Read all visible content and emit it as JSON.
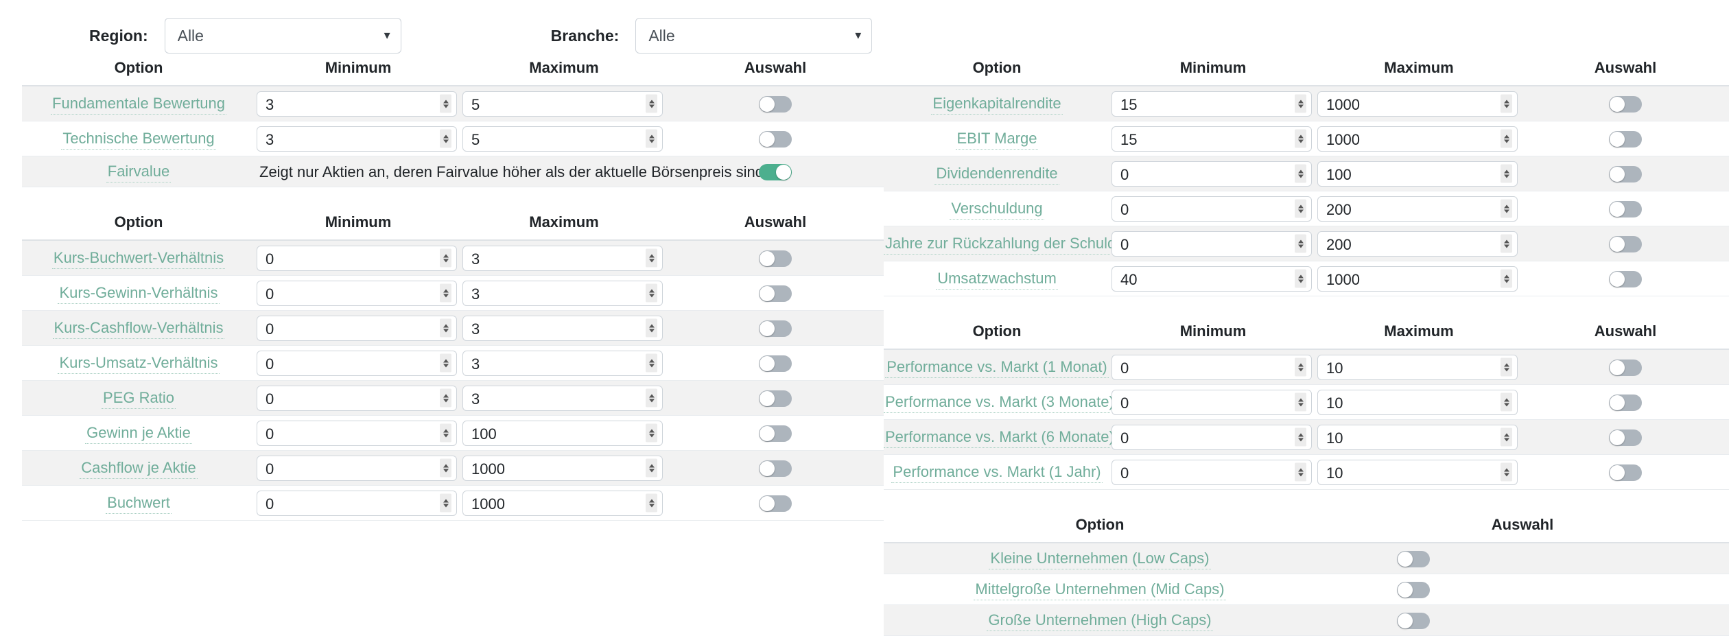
{
  "filters": {
    "region": {
      "label": "Region:",
      "value": "Alle",
      "options": [
        "Alle"
      ]
    },
    "branche": {
      "label": "Branche:",
      "value": "Alle",
      "options": [
        "Alle"
      ]
    },
    "caret_icon": "chevron-down-icon"
  },
  "headers": {
    "option": "Option",
    "minimum": "Minimum",
    "maximum": "Maximum",
    "auswahl": "Auswahl"
  },
  "left": {
    "table1": {
      "rows": [
        {
          "label": "Fundamentale Bewertung",
          "min": "3",
          "max": "5",
          "toggle": "off"
        },
        {
          "label": "Technische Bewertung",
          "min": "3",
          "max": "5",
          "toggle": "off"
        }
      ],
      "fairvalue": {
        "label": "Fairvalue",
        "note": "Zeigt nur Aktien an, deren Fairvalue höher als der aktuelle Börsenpreis sind.",
        "toggle": "on"
      }
    },
    "table2": {
      "rows": [
        {
          "label": "Kurs-Buchwert-Verhältnis",
          "min": "0",
          "max": "3",
          "toggle": "off"
        },
        {
          "label": "Kurs-Gewinn-Verhältnis",
          "min": "0",
          "max": "3",
          "toggle": "off"
        },
        {
          "label": "Kurs-Cashflow-Verhältnis",
          "min": "0",
          "max": "3",
          "toggle": "off"
        },
        {
          "label": "Kurs-Umsatz-Verhältnis",
          "min": "0",
          "max": "3",
          "toggle": "off"
        },
        {
          "label": "PEG Ratio",
          "min": "0",
          "max": "3",
          "toggle": "off"
        },
        {
          "label": "Gewinn je Aktie",
          "min": "0",
          "max": "100",
          "toggle": "off"
        },
        {
          "label": "Cashflow je Aktie",
          "min": "0",
          "max": "1000",
          "toggle": "off"
        },
        {
          "label": "Buchwert",
          "min": "0",
          "max": "1000",
          "toggle": "off"
        }
      ]
    }
  },
  "right": {
    "table1": {
      "rows": [
        {
          "label": "Eigenkapitalrendite",
          "min": "15",
          "max": "1000",
          "toggle": "off"
        },
        {
          "label": "EBIT Marge",
          "min": "15",
          "max": "1000",
          "toggle": "off"
        },
        {
          "label": "Dividendenrendite",
          "min": "0",
          "max": "100",
          "toggle": "off"
        },
        {
          "label": "Verschuldung",
          "min": "0",
          "max": "200",
          "toggle": "off"
        },
        {
          "label": "Jahre zur Rückzahlung der Schulden",
          "min": "0",
          "max": "200",
          "toggle": "off"
        },
        {
          "label": "Umsatzwachstum",
          "min": "40",
          "max": "1000",
          "toggle": "off"
        }
      ]
    },
    "table2": {
      "rows": [
        {
          "label": "Performance vs. Markt (1 Monat)",
          "min": "0",
          "max": "10",
          "toggle": "off"
        },
        {
          "label": "Performance vs. Markt (3 Monate)",
          "min": "0",
          "max": "10",
          "toggle": "off"
        },
        {
          "label": "Performance vs. Markt (6 Monate)",
          "min": "0",
          "max": "10",
          "toggle": "off"
        },
        {
          "label": "Performance vs. Markt (1 Jahr)",
          "min": "0",
          "max": "10",
          "toggle": "off"
        }
      ]
    },
    "table3": {
      "rows": [
        {
          "label": "Kleine Unternehmen (Low Caps)",
          "toggle": "off"
        },
        {
          "label": "Mittelgroße Unternehmen (Mid Caps)",
          "toggle": "off"
        },
        {
          "label": "Große Unternehmen (High Caps)",
          "toggle": "off"
        }
      ]
    }
  },
  "colors": {
    "link_green": "#70ad9a",
    "toggle_on": "#4caf8e",
    "toggle_off": "#adb5bd",
    "row_stripe": "#f2f2f2"
  }
}
